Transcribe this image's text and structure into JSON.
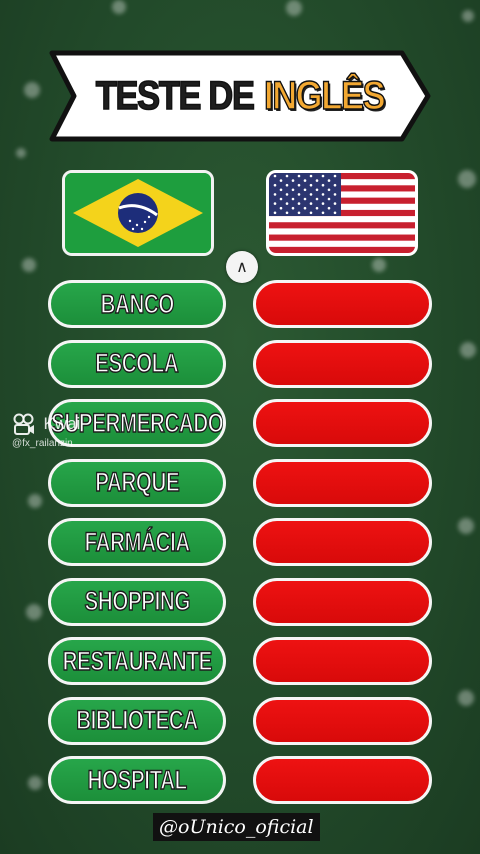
{
  "title": {
    "part1": "TESTE DE",
    "part2": "INGLÊS"
  },
  "flags": {
    "left": {
      "country": "brazil-flag-icon"
    },
    "right": {
      "country": "usa-flag-icon"
    }
  },
  "words": [
    "BANCO",
    "ESCOLA",
    "SUPERMERCADO",
    "PARQUE",
    "FARMÁCIA",
    "SHOPPING",
    "RESTAURANTE",
    "BIBLIOTECA",
    "HOSPITAL"
  ],
  "watermark": {
    "app": "Kwai",
    "user": "@fx_railanzin"
  },
  "handle": "@oUnico_oficial",
  "cursor_glyph": "∧",
  "colors": {
    "background": "#224a2a",
    "word_pill": "#1f9a40",
    "answer_pill": "#e30e0e",
    "title_accent": "#f2a832"
  }
}
